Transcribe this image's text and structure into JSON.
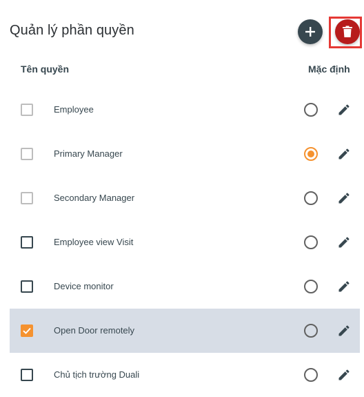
{
  "header": {
    "title": "Quản lý phần quyền",
    "add_icon": "plus-icon",
    "delete_icon": "trash-icon"
  },
  "columns": {
    "name": "Tên quyền",
    "default": "Mặc định"
  },
  "roles": [
    {
      "label": "Employee",
      "checked": false,
      "checkbox_style": "light",
      "default": false
    },
    {
      "label": "Primary Manager",
      "checked": false,
      "checkbox_style": "light",
      "default": true
    },
    {
      "label": "Secondary Manager",
      "checked": false,
      "checkbox_style": "light",
      "default": false
    },
    {
      "label": "Employee view Visit",
      "checked": false,
      "checkbox_style": "dark",
      "default": false
    },
    {
      "label": "Device monitor",
      "checked": false,
      "checkbox_style": "dark",
      "default": false
    },
    {
      "label": "Open Door remotely",
      "checked": true,
      "checkbox_style": "dark",
      "default": false
    },
    {
      "label": "Chủ tịch trường Duali",
      "checked": false,
      "checkbox_style": "dark",
      "default": false
    }
  ],
  "colors": {
    "accent": "#f5922f",
    "add_button": "#37474f",
    "delete_button": "#b71c1c",
    "selected_row": "#d7dde6"
  }
}
